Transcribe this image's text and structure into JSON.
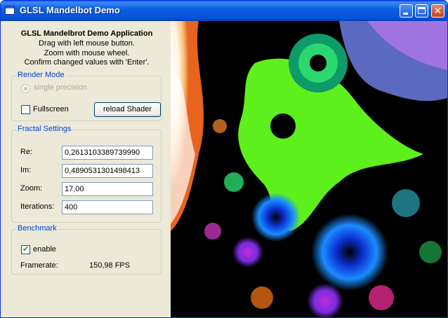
{
  "window": {
    "title": "GLSL Mandelbot Demo",
    "icons": [
      "app-icon",
      "minimize-icon",
      "maximize-icon",
      "close-icon"
    ]
  },
  "header": {
    "title": "GLSL Mandelbrot Demo Application",
    "line1": "Drag with left mouse button.",
    "line2": "Zoom with mouse wheel.",
    "line3": "Confirm changed values with 'Enter'."
  },
  "render_mode": {
    "title": "Render Mode",
    "option_label": "single precision",
    "fullscreen_label": "Fullscreen",
    "fullscreen_checked": false,
    "reload_label": "reload Shader"
  },
  "fractal": {
    "title": "Fractal Settings",
    "re_label": "Re:",
    "re_value": "0,2613103389739990",
    "im_label": "Im:",
    "im_value": "0,4890531301498413",
    "zoom_label": "Zoom:",
    "zoom_value": "17,00",
    "iterations_label": "Iterations:",
    "iterations_value": "400"
  },
  "benchmark": {
    "title": "Benchmark",
    "enable_label": "enable",
    "enable_checked": true,
    "framerate_label": "Framerate:",
    "framerate_value": "150,98 FPS"
  },
  "colors": {
    "title_bar": "#0453d8",
    "group_title": "#0046d5",
    "window_bg": "#ece9d8",
    "fractal_green": "#5ef01c"
  }
}
